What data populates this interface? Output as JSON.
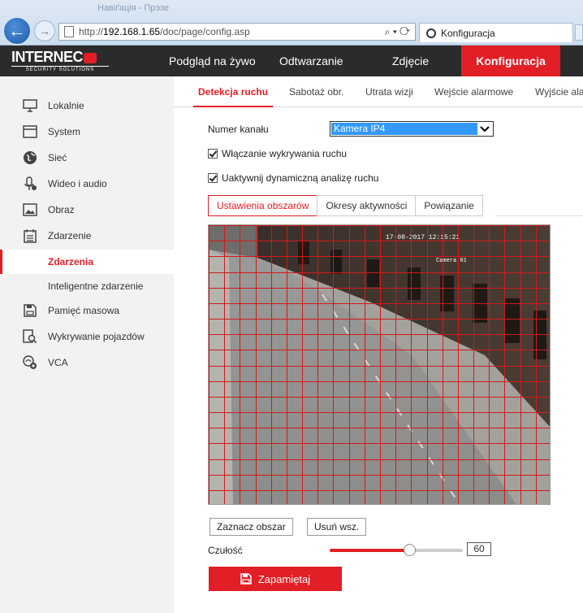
{
  "browser": {
    "back_glyph": "←",
    "forward_glyph": "→",
    "title_ghost": "Навіґація - Прэзе",
    "url_prefix": "http://",
    "url_host": "192.168.1.65",
    "url_path": "/doc/page/config.asp",
    "address_tools": "⌕ ▾ ⟳",
    "tab_title": "Konfiguracja"
  },
  "header": {
    "logo_main": "INTERNEC",
    "logo_sub": "SECURITY SOLUTIONS",
    "nav": {
      "live": "Podgląd na żywo",
      "playback": "Odtwarzanie",
      "picture": "Zdjęcie",
      "config": "Konfiguracja"
    }
  },
  "sidebar": {
    "items": [
      {
        "label": "Lokalnie",
        "icon": "monitor-icon"
      },
      {
        "label": "System",
        "icon": "window-icon"
      },
      {
        "label": "Sieć",
        "icon": "globe-icon"
      },
      {
        "label": "Wideo i audio",
        "icon": "microphone-icon"
      },
      {
        "label": "Obraz",
        "icon": "image-icon"
      },
      {
        "label": "Zdarzenie",
        "icon": "calendar-icon"
      },
      {
        "label": "Zdarzenia",
        "active": true
      },
      {
        "label": "Inteligentne zdarzenie"
      },
      {
        "label": "Pamięć masowa",
        "icon": "disk-icon"
      },
      {
        "label": "Wykrywanie pojazdów",
        "icon": "vehicle-search-icon"
      },
      {
        "label": "VCA",
        "icon": "vca-icon"
      }
    ]
  },
  "tabs": {
    "motion": "Detekcja ruchu",
    "tamper": "Sabotaż obr.",
    "video_loss": "Utrata wizji",
    "alarm_in": "Wejście alarmowe",
    "alarm_out": "Wyjście ala"
  },
  "form": {
    "channel_label": "Numer kanału",
    "channel_value": "Kamera IP4",
    "enable_motion": "Włączanie wykrywania ruchu",
    "dynamic_analysis": "Uaktywnij dynamiczną analizę ruchu",
    "subtabs": {
      "area": "Ustawienia obszarów",
      "schedule": "Okresy aktywności",
      "linkage": "Powiązanie"
    },
    "video_osd_time": "17-08-2017 12:15:21",
    "video_osd_name": "Camera 01",
    "mark_area": "Zaznacz obszar",
    "clear_all": "Usuń wsz.",
    "sensitivity_label": "Czułość",
    "sensitivity_value": "60",
    "sensitivity_level": 0.6,
    "save": "Zapamiętaj"
  },
  "colors": {
    "accent": "#e21e26",
    "header_bg": "#2b2b2b",
    "sidebar_bg": "#f2f2f2",
    "selection": "#3399ff"
  }
}
